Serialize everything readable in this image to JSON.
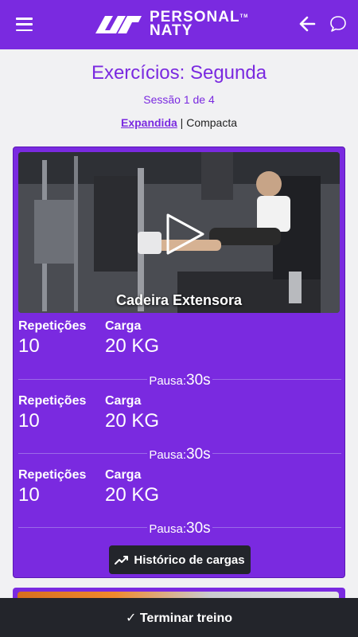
{
  "header": {
    "brand_line1": "PERSONAL",
    "brand_line2": "NATY",
    "trademark": "TM",
    "icons": {
      "menu": "hamburger-menu-icon",
      "back": "arrow-left-icon",
      "chat": "chat-bubble-icon"
    }
  },
  "page": {
    "title": "Exercícios: Segunda",
    "session": "Sessão 1 de 4",
    "view_expanded": "Expandida",
    "view_separator": " | ",
    "view_compact": "Compacta"
  },
  "exercise": {
    "name": "Cadeira Extensora",
    "sets": [
      {
        "reps_label": "Repetições",
        "reps": "10",
        "load_label": "Carga",
        "load": "20 KG",
        "pause_label": "Pausa:",
        "pause": "30s"
      },
      {
        "reps_label": "Repetições",
        "reps": "10",
        "load_label": "Carga",
        "load": "20 KG",
        "pause_label": "Pausa:",
        "pause": "30s"
      },
      {
        "reps_label": "Repetições",
        "reps": "10",
        "load_label": "Carga",
        "load": "20 KG",
        "pause_label": "Pausa:",
        "pause": "30s"
      }
    ],
    "history_button": "Histórico de cargas"
  },
  "footer": {
    "finish_button": "✓ Terminar treino"
  },
  "colors": {
    "primary": "#7a2ae0",
    "dark": "#23252b",
    "background": "#f1f1f3"
  }
}
